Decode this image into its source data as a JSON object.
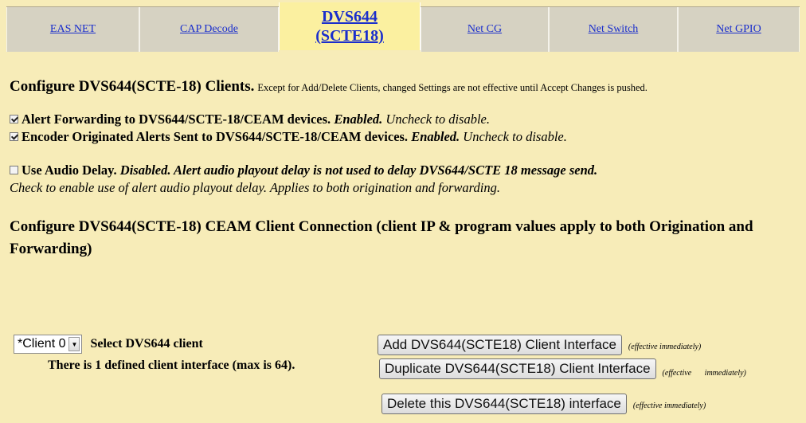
{
  "tabs": [
    {
      "label": "EAS NET"
    },
    {
      "label": "CAP Decode"
    },
    {
      "label_line1": "DVS644",
      "label_line2": "(SCTE18)"
    },
    {
      "label": "Net CG"
    },
    {
      "label": "Net Switch"
    },
    {
      "label": "Net GPIO"
    }
  ],
  "configure": {
    "title": "Configure DVS644(SCTE-18) Clients.",
    "note": "Except for Add/Delete Clients, changed Settings are not effective until Accept Changes is pushed."
  },
  "options": {
    "alert_forwarding": {
      "label": "Alert Forwarding to DVS644/SCTE-18/CEAM devices.",
      "state": "Enabled.",
      "hint": "Uncheck to disable.",
      "checked": true
    },
    "encoder_alerts": {
      "label": "Encoder Originated Alerts Sent to DVS644/SCTE-18/CEAM devices.",
      "state": "Enabled.",
      "hint": "Uncheck to disable.",
      "checked": true
    },
    "audio_delay": {
      "label": "Use Audio Delay.",
      "state": "Disabled. Alert audio playout delay is not used to delay DVS644/SCTE 18 message send.",
      "hint": "Check to enable use of alert audio playout delay. Applies to both origination and forwarding.",
      "checked": false
    }
  },
  "connection": {
    "title": "Configure DVS644(SCTE-18) CEAM Client Connection (client IP & program values apply to both Origination and Forwarding)"
  },
  "client": {
    "selected": "*Client 0",
    "select_label": "Select DVS644 client",
    "count_text": "There is 1 defined client interface (max is 64)."
  },
  "buttons": {
    "add": "Add DVS644(SCTE18) Client Interface",
    "duplicate": "Duplicate DVS644(SCTE18) Client Interface",
    "delete": "Delete this DVS644(SCTE18) interface",
    "effective": "(effective immediately)"
  }
}
